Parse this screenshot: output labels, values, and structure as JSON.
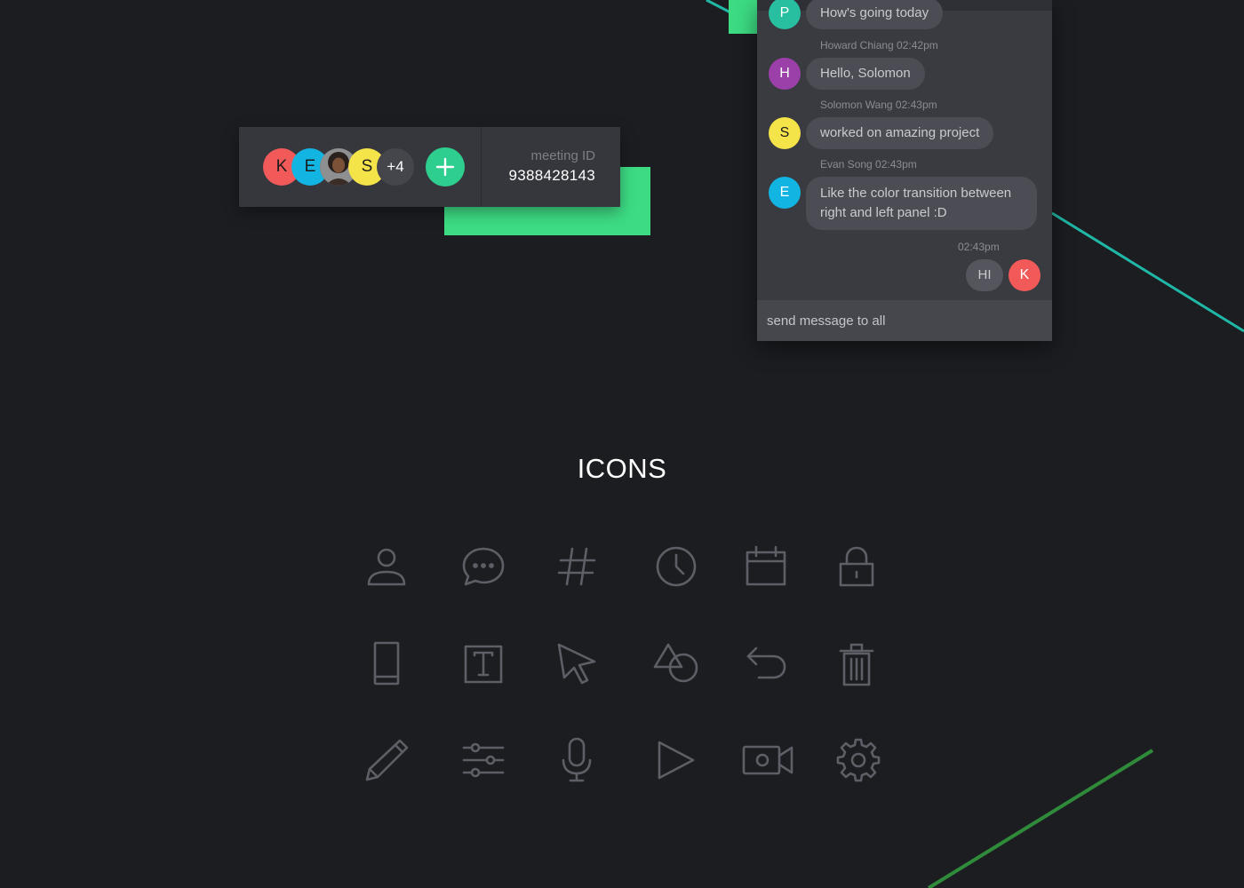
{
  "colors": {
    "background": "#1c1d21",
    "accent_green": "#3ddc84",
    "accent_teal": "#1fb8a6",
    "line_green": "#2f8a3a",
    "panel": "#36373d",
    "icon_stroke": "#5d5f66"
  },
  "meeting": {
    "participants": [
      {
        "initial": "K",
        "color": "#f25a5a"
      },
      {
        "initial": "E",
        "color": "#12b5e2"
      },
      {
        "initial": "",
        "color": "#6b4f3f",
        "kind": "photo"
      },
      {
        "initial": "S",
        "color": "#f5e34a"
      }
    ],
    "more_count": "+4",
    "add_icon": "plus-icon",
    "id_label": "meeting ID",
    "id_value": "9388428143"
  },
  "chat": {
    "messages": [
      {
        "initial": "P",
        "avatar_color": "#27bfa0",
        "text": "How's going today"
      },
      {
        "meta": "Howard Chiang 02:42pm",
        "initial": "H",
        "avatar_color": "#9b3fa9",
        "text": "Hello, Solomon"
      },
      {
        "meta": "Solomon Wang 02:43pm",
        "initial": "S",
        "avatar_color": "#f5e34a",
        "text": "worked on amazing project"
      },
      {
        "meta": "Evan Song 02:43pm",
        "initial": "E",
        "avatar_color": "#12b5e2",
        "text": "Like the color transition between right and left panel :D"
      }
    ],
    "own_message": {
      "meta": "02:43pm",
      "text": "HI",
      "initial": "K",
      "avatar_color": "#f25a5a"
    },
    "input_placeholder": "send message to all"
  },
  "icons_section": {
    "title": "ICONS",
    "rows": [
      [
        "user-icon",
        "chat-icon",
        "hashtag-icon",
        "clock-icon",
        "calendar-icon",
        "lock-icon"
      ],
      [
        "phone-icon",
        "text-icon",
        "cursor-icon",
        "shapes-icon",
        "undo-icon",
        "trash-icon"
      ],
      [
        "pencil-icon",
        "sliders-icon",
        "microphone-icon",
        "play-icon",
        "video-camera-icon",
        "gear-icon"
      ]
    ]
  }
}
